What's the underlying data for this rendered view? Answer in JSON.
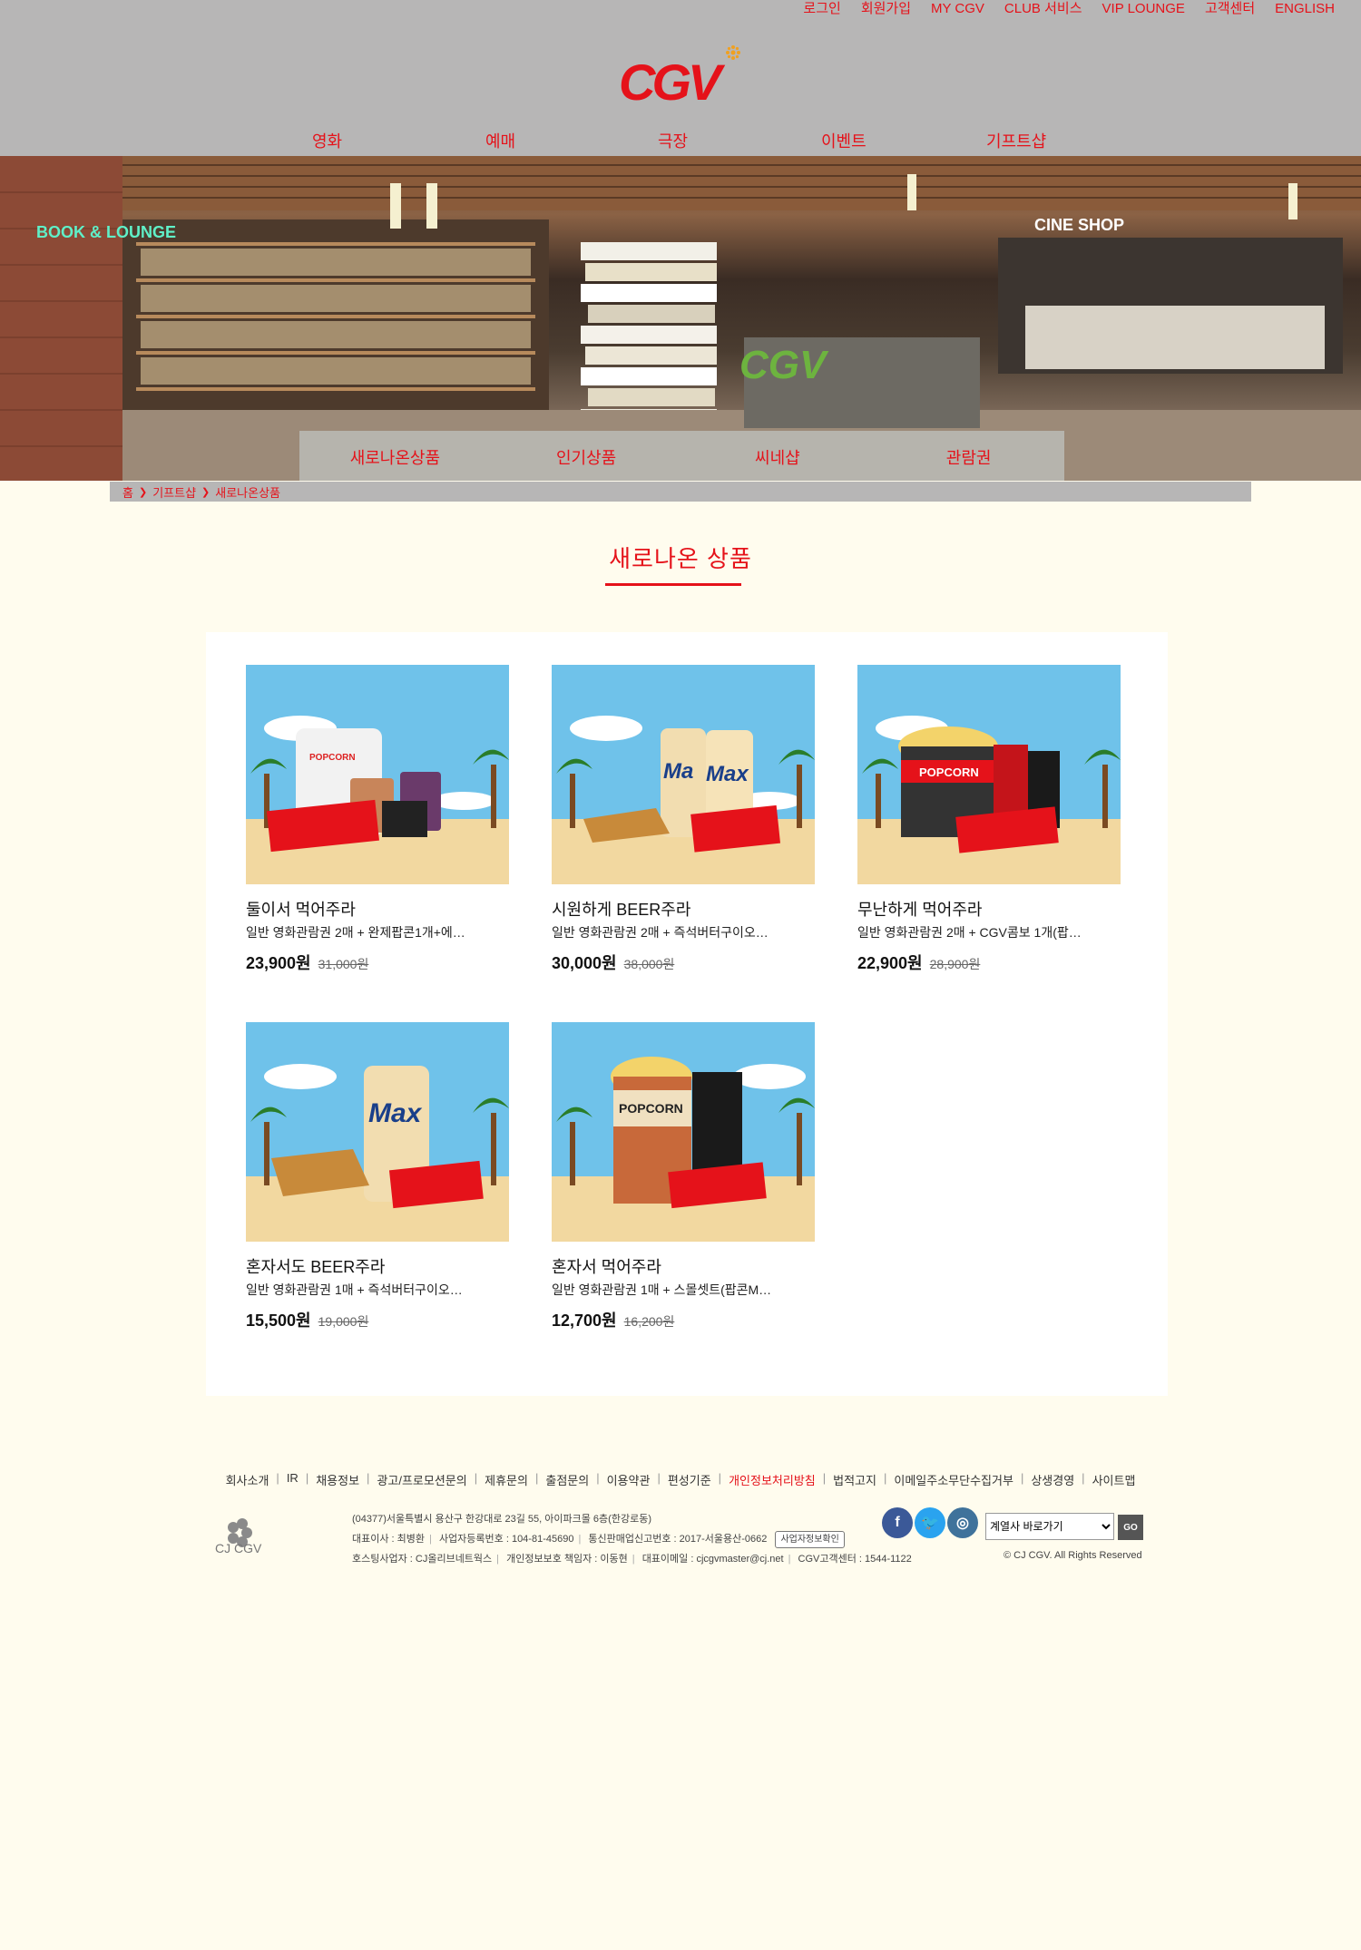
{
  "header": {
    "util_nav": [
      "로그인",
      "회원가입",
      "MY CGV",
      "CLUB 서비스",
      "VIP LOUNGE",
      "고객센터",
      "ENGLISH"
    ],
    "logo_text": "CGV",
    "gnb": [
      "영화",
      "예매",
      "극장",
      "이벤트",
      "기프트샵"
    ]
  },
  "hero": {
    "signs": [
      "BOOK & LOUNGE",
      "CINE SHOP"
    ],
    "subtabs": [
      "새로나온상품",
      "인기상품",
      "씨네샵",
      "관람권"
    ]
  },
  "breadcrumb": [
    "홈",
    "기프트샵",
    "새로나온상품"
  ],
  "section_title": "새로나온 상품",
  "products": [
    {
      "name": "둘이서 먹어주라",
      "desc": "일반 영화관람권 2매 + 완제팝콘1개+에…",
      "price": "23,900원",
      "orig_price": "31,000원"
    },
    {
      "name": "시원하게 BEER주라",
      "desc": "일반 영화관람권 2매 + 즉석버터구이오…",
      "price": "30,000원",
      "orig_price": "38,000원"
    },
    {
      "name": "무난하게 먹어주라",
      "desc": "일반 영화관람권 2매 + CGV콤보 1개(팝…",
      "price": "22,900원",
      "orig_price": "28,900원"
    },
    {
      "name": "혼자서도 BEER주라",
      "desc": "일반 영화관람권 1매 + 즉석버터구이오…",
      "price": "15,500원",
      "orig_price": "19,000원"
    },
    {
      "name": "혼자서 먹어주라",
      "desc": "일반 영화관람권 1매 + 스몰셋트(팝콘M…",
      "price": "12,700원",
      "orig_price": "16,200원"
    }
  ],
  "footer": {
    "links": [
      "회사소개",
      "IR",
      "채용정보",
      "광고/프로모션문의",
      "제휴문의",
      "출점문의",
      "이용약관",
      "편성기준",
      "개인정보처리방침",
      "법적고지",
      "이메일주소무단수집거부",
      "상생경영",
      "사이트맵"
    ],
    "highlight_link": "개인정보처리방침",
    "cj_logo_text": "CJ CGV",
    "address": "(04377)서울특별시 용산구 한강대로 23길 55, 아이파크몰 6층(한강로동)",
    "info_line2": [
      "대표이사 : 최병환",
      "사업자등록번호 : 104-81-45690",
      "통신판매업신고번호 : 2017-서울용산-0662"
    ],
    "biz_check_btn": "사업자정보확인",
    "info_line3": [
      "호스팅사업자 : CJ올리브네트웍스",
      "개인정보보호 책임자 : 이동현",
      "대표이메일 : cjcgvmaster@cj.net",
      "CGV고객센터 : 1544-1122"
    ],
    "sns": [
      "facebook-icon",
      "twitter-icon",
      "instagram-icon"
    ],
    "select_value": "계열사 바로가기",
    "go_label": "GO",
    "copyright": "© CJ CGV. All Rights Reserved"
  },
  "colors": {
    "accent": "#e5121a",
    "header_bg": "#b7b6b6",
    "page_bg": "#fffcee"
  }
}
